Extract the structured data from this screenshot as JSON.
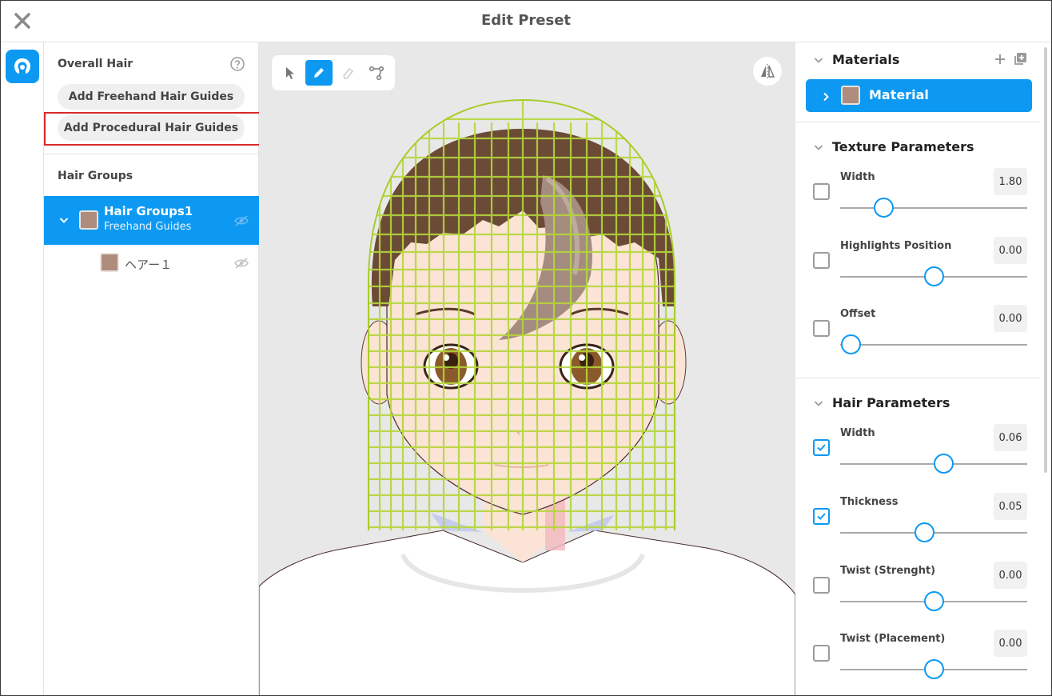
{
  "window": {
    "title": "Edit Preset",
    "close_icon": "close-icon"
  },
  "rail": {
    "active_icon": "hair-tab-icon",
    "accent": "#0d99f2"
  },
  "overall_hair": {
    "heading": "Overall Hair",
    "help_icon": "help-icon",
    "add_freehand": "Add Freehand Hair Guides",
    "add_procedural": "Add Procedural Hair Guides"
  },
  "hair_groups": {
    "heading": "Hair Groups",
    "groups": [
      {
        "name": "Hair Groups1",
        "subtitle": "Freehand Guides",
        "color": "#ae8c7e",
        "expanded": true,
        "selected": true,
        "children": [
          {
            "name": "ヘアー１",
            "color": "#ae8c7e"
          }
        ]
      }
    ]
  },
  "viewport": {
    "tools": [
      "select-tool-icon",
      "pen-tool-icon",
      "eraser-tool-icon",
      "path-tool-icon"
    ],
    "active_tool": "pen-tool-icon",
    "mirror_icon": "mirror-icon"
  },
  "materials": {
    "heading": "Materials",
    "add_icon": "plus-icon",
    "duplicate_icon": "duplicate-icon",
    "items": [
      {
        "name": "Material",
        "color": "#ae8c7e",
        "selected": true
      }
    ]
  },
  "texture_parameters": {
    "heading": "Texture Parameters",
    "params": [
      {
        "label": "Width",
        "value": "1.80",
        "checked": false,
        "slider": 0.23
      },
      {
        "label": "Highlights Position",
        "value": "0.00",
        "checked": false,
        "slider": 0.5
      },
      {
        "label": "Offset",
        "value": "0.00",
        "checked": false,
        "slider": 0.055
      }
    ]
  },
  "hair_parameters": {
    "heading": "Hair Parameters",
    "params": [
      {
        "label": "Width",
        "value": "0.06",
        "checked": true,
        "slider": 0.55
      },
      {
        "label": "Thickness",
        "value": "0.05",
        "checked": true,
        "slider": 0.45
      },
      {
        "label": "Twist (Strenght)",
        "value": "0.00",
        "checked": false,
        "slider": 0.5
      },
      {
        "label": "Twist (Placement)",
        "value": "0.00",
        "checked": false,
        "slider": 0.5
      }
    ]
  }
}
